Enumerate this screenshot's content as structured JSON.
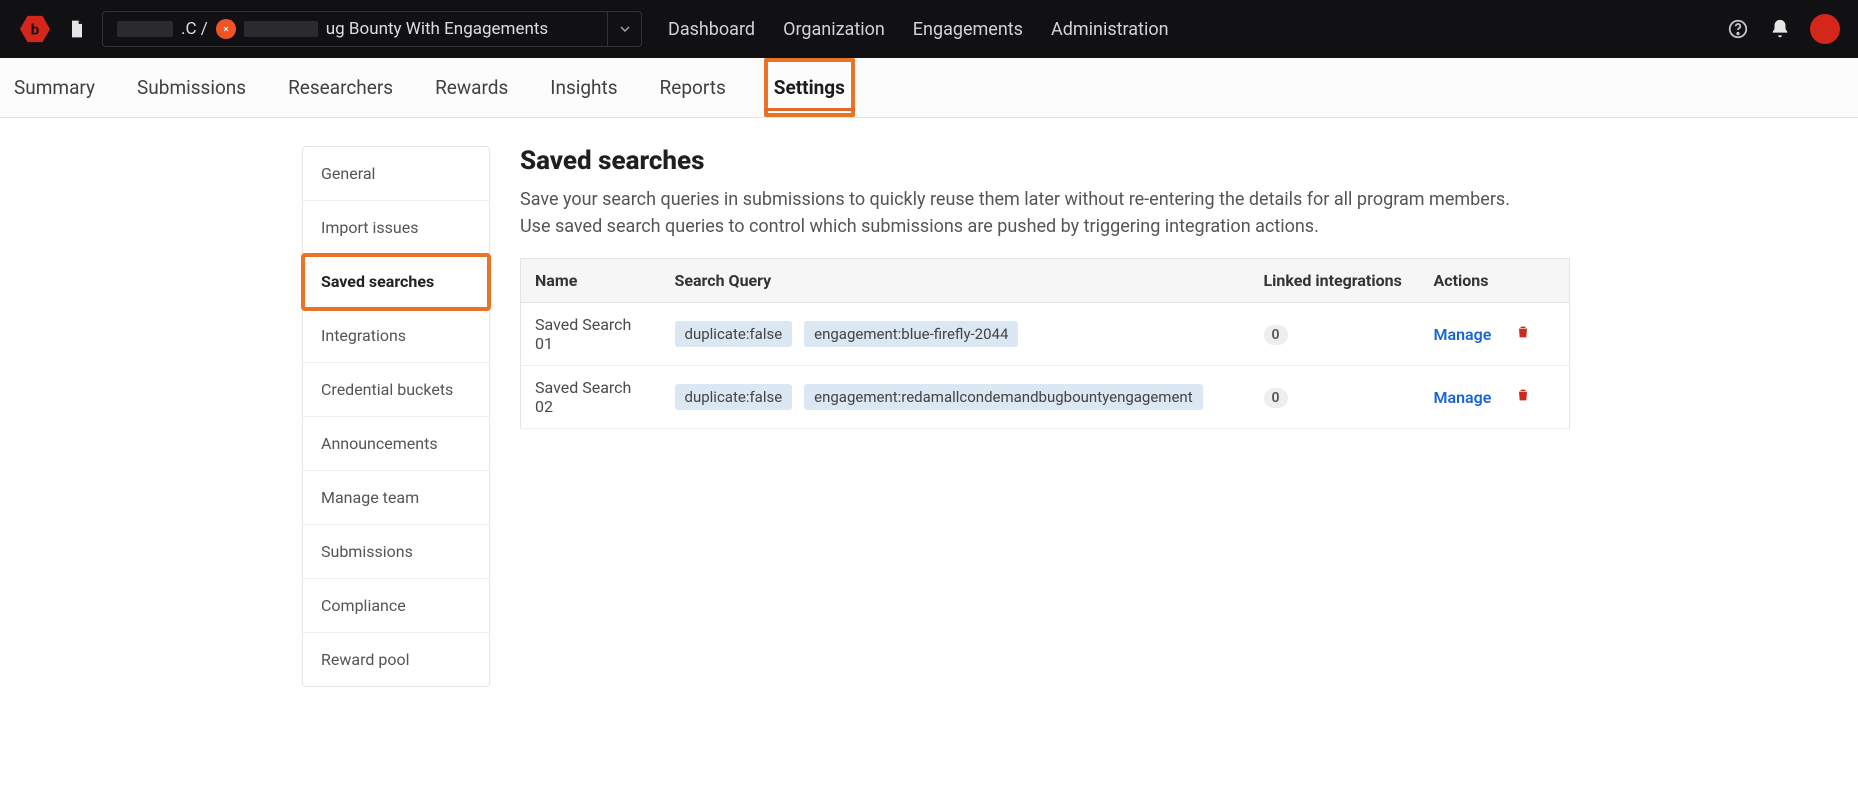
{
  "topnav": {
    "breadcrumb_prefix": ".C /",
    "breadcrumb_rest": "ug Bounty With Engagements",
    "items": [
      "Dashboard",
      "Organization",
      "Engagements",
      "Administration"
    ]
  },
  "tabs": {
    "items": [
      "Summary",
      "Submissions",
      "Researchers",
      "Rewards",
      "Insights",
      "Reports",
      "Settings"
    ],
    "active_index": 6
  },
  "sidebar": {
    "items": [
      "General",
      "Import issues",
      "Saved searches",
      "Integrations",
      "Credential buckets",
      "Announcements",
      "Manage team",
      "Submissions",
      "Compliance",
      "Reward pool"
    ],
    "active_index": 2
  },
  "page": {
    "title": "Saved searches",
    "description": "Save your search queries in submissions to quickly reuse them later without re-entering the details for all program members. Use saved search queries to control which submissions are pushed by triggering integration actions."
  },
  "table": {
    "headers": {
      "name": "Name",
      "query": "Search Query",
      "linked": "Linked integrations",
      "actions": "Actions"
    },
    "manage_label": "Manage",
    "rows": [
      {
        "name": "Saved Search 01",
        "chips": [
          "duplicate:false",
          "engagement:blue-firefly-2044"
        ],
        "linked": "0"
      },
      {
        "name": "Saved Search 02",
        "chips": [
          "duplicate:false",
          "engagement:redamallcondemandbugbountyengagement"
        ],
        "linked": "0"
      }
    ]
  }
}
